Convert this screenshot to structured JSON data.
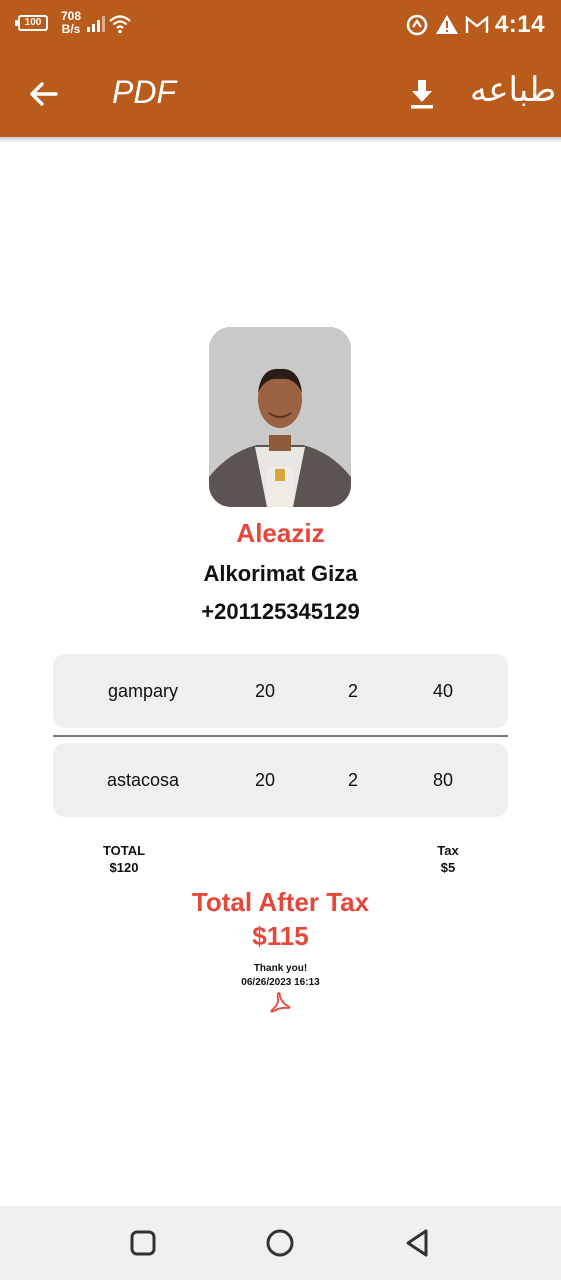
{
  "status_bar": {
    "battery": "100",
    "net_speed_value": "708",
    "net_speed_unit": "B/s",
    "time": "4:14"
  },
  "app_bar": {
    "title": "PDF",
    "print_label": "طباعه"
  },
  "profile": {
    "name": "Aleaziz",
    "address": "Alkorimat Giza",
    "phone": "+201125345129"
  },
  "items": [
    {
      "name": "gampary",
      "price": "20",
      "qty": "2",
      "amount": "40"
    },
    {
      "name": "astacosa",
      "price": "20",
      "qty": "2",
      "amount": "80"
    }
  ],
  "totals": {
    "total_label": "TOTAL",
    "total_value": "$120",
    "tax_label": "Tax",
    "tax_value": "$5",
    "after_tax_label": "Total After Tax",
    "after_tax_value": "$115"
  },
  "footer": {
    "thanks": "Thank you!",
    "datetime": "06/26/2023 16:13"
  },
  "colors": {
    "app_bar": "#b95c1b",
    "accent_red": "#e5483b",
    "row_bg": "#efefef"
  }
}
